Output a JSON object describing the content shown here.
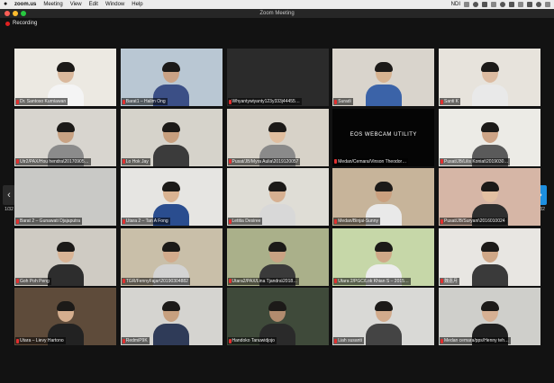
{
  "menubar": {
    "app": "zoom.us",
    "items": [
      "Meeting",
      "View",
      "Edit",
      "Window",
      "Help"
    ],
    "right_text": "NDI"
  },
  "window": {
    "title": "Zoom Meeting"
  },
  "recording": {
    "label": "Recording"
  },
  "pagination": {
    "left_page": "1/32",
    "right_page": "1/32"
  },
  "colors": {
    "tile_bg": "#2b2b2b",
    "recording_red": "#e02020",
    "active_arrow": "#1d8fe0"
  },
  "participants": [
    {
      "name": "Dr. Santoso Kurniawan",
      "bg": "#ece9e2",
      "skin": "#d9b89c",
      "shirt": "#f4f4f4"
    },
    {
      "name": "Barat1 – Halim Ong",
      "bg": "#b9c7d3",
      "skin": "#caa285",
      "shirt": "#3b4f86"
    },
    {
      "name": "Whyantywiyanty123y333j44455…",
      "bg": "#2b2b2b",
      "video": false
    },
    {
      "name": "Suradi",
      "bg": "#d9d4cc",
      "skin": "#d7b391",
      "shirt": "#3b63a8"
    },
    {
      "name": "Santi K",
      "bg": "#e7e3dc",
      "skin": "#dcbba1",
      "shirt": "#e9e9e9"
    },
    {
      "name": "Utr2/PAX/Hou hendra\\20170905…",
      "bg": "#d8d5cf",
      "skin": "#c8a283",
      "shirt": "#8b8b8b"
    },
    {
      "name": "Lo Hok Jay",
      "bg": "#d6d3cb",
      "skin": "#c79f7e",
      "shirt": "#3b3b3b"
    },
    {
      "name": "Pusat/JB/Myra Aulia\\2019120057",
      "bg": "#d7d2c8",
      "skin": "#e0be9f",
      "shirt": "#8a8a8a"
    },
    {
      "name": "Medan/Cemara/Vinson Theodor…",
      "bg": "#050505",
      "video": false,
      "overlay": "EOS WEBCAM UTILITY"
    },
    {
      "name": "Pusat/JB/Lilis Koniat\\2019030…",
      "bg": "#ecebe6",
      "skin": "#cda486",
      "shirt": "#5a5a5a"
    },
    {
      "name": "Barat 2 – Gunawati Djajaputra",
      "bg": "#c9c9c6",
      "video": false
    },
    {
      "name": "Utara 2 – Tan A Fong",
      "bg": "#e6e5e2",
      "skin": "#d9b392",
      "shirt": "#2a4d8f"
    },
    {
      "name": "Letitia Desiree",
      "bg": "#dfddd6",
      "skin": "#d6b091",
      "shirt": "#d8d8d8"
    },
    {
      "name": "Medan/Binjai-Sunny",
      "bg": "#c7b49a",
      "skin": "#caa07f",
      "shirt": "#e9e9e9"
    },
    {
      "name": "Pusat/JB/Suryani\\2016010024",
      "bg": "#d6b6a6",
      "skin": "#e2c0a2",
      "shirt": "#2e2e2e"
    },
    {
      "name": "Goh Poh Peng",
      "bg": "#cfcbc3",
      "skin": "#d9b495",
      "shirt": "#2d2d2d"
    },
    {
      "name": "TGR/FennyFajar\\20190304882",
      "bg": "#c9bfa9",
      "skin": "#d2ab8c",
      "shirt": "#d3d3d3"
    },
    {
      "name": "Utara2/PAX/Lina Tjandra\\2018…",
      "bg": "#aab08a",
      "skin": "#c9a283",
      "shirt": "#3a3a3a"
    },
    {
      "name": "Utara 2/PGC/Lok Khian S – 2015…",
      "bg": "#c6d7a8",
      "skin": "#cfa888",
      "shirt": "#ececec"
    },
    {
      "name": "魏嘉月",
      "bg": "#e8e6e2",
      "skin": "#cfa787",
      "shirt": "#3a3a3a"
    },
    {
      "name": "Utara – Lievy Hartono",
      "bg": "#5e4b3a",
      "skin": "#d5ae8e",
      "shirt": "#222222"
    },
    {
      "name": "RedmiP9K",
      "bg": "#d5d4d0",
      "skin": "#c7a07f",
      "shirt": "#2f3b58"
    },
    {
      "name": "Handoko Tanuwidjojo",
      "bg": "#3f4a3a",
      "skin": "#b18b6e",
      "shirt": "#2a2a2a"
    },
    {
      "name": "Liah susanti",
      "bg": "#d9d9d6",
      "skin": "#d2ab8c",
      "shirt": "#444444"
    },
    {
      "name": "Medan cemara/pps/Henny teh…",
      "bg": "#cfcfcb",
      "skin": "#d6b093",
      "shirt": "#1f1f1f"
    }
  ]
}
